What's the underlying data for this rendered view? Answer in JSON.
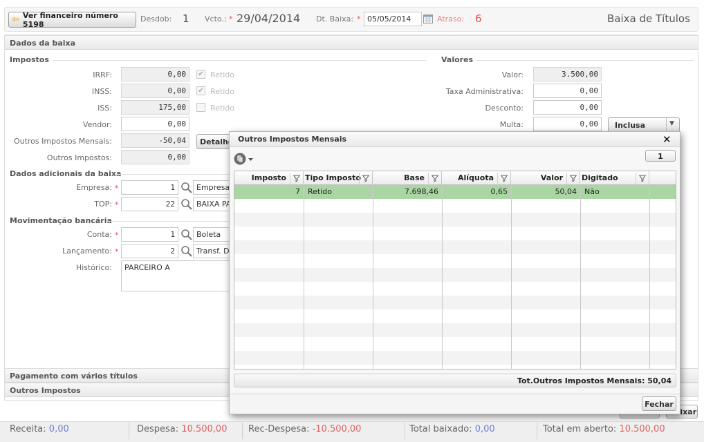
{
  "header": {
    "ver_financeiro_label": "Ver financeiro número 5198",
    "desdob_label": "Desdob:",
    "desdob_value": "1",
    "vcto_label": "Vcto.:",
    "vcto_value": "29/04/2014",
    "dt_baixa_label": "Dt. Baixa:",
    "dt_baixa_value": "05/05/2014",
    "atraso_label": "Atraso:",
    "atraso_value": "6",
    "page_title": "Baixa de Títulos",
    "required_mark": "*"
  },
  "dados_baixa": {
    "title": "Dados da baixa",
    "impostos_title": "Impostos",
    "impostos": [
      {
        "label": "IRRF:",
        "value": "0,00",
        "retido_label": "Retido",
        "checked": true
      },
      {
        "label": "INSS:",
        "value": "0,00",
        "retido_label": "Retido",
        "checked": true
      },
      {
        "label": "ISS:",
        "value": "175,00",
        "retido_label": "Retido",
        "checked": false
      }
    ],
    "vendor_label": "Vendor:",
    "vendor_value": "0,00",
    "outros_mensais_label": "Outros Impostos Mensais:",
    "outros_mensais_value": "-50,04",
    "detalhes_label": "Detalhes",
    "outros_impostos_label": "Outros Impostos:",
    "outros_impostos_value": "0,00",
    "valores_title": "Valores",
    "valor_label": "Valor:",
    "valor_value": "3.500,00",
    "taxa_label": "Taxa Administrativa:",
    "taxa_value": "0,00",
    "desconto_label": "Desconto:",
    "desconto_value": "0,00",
    "multa_label": "Multa:",
    "multa_value": "0,00",
    "multa_option": "Inclusa",
    "adicionais_title": "Dados adicionais da baixa",
    "empresa_label": "Empresa:",
    "empresa_code": "1",
    "empresa_name": "Empresa",
    "top_label": "TOP:",
    "top_code": "22",
    "top_name": "BAIXA PA",
    "mov_title": "Movimentação bancária",
    "conta_label": "Conta:",
    "conta_code": "1",
    "conta_name": "Boleta",
    "lancamento_label": "Lançamento:",
    "lancamento_code": "2",
    "lancamento_name": "Transf. D",
    "historico_label": "Histórico:",
    "historico_value": "PARCEIRO A"
  },
  "collapsed_sections": [
    "Pagamento com vários títulos",
    "Outros Impostos"
  ],
  "modal": {
    "title": "Outros Impostos Mensais",
    "close_symbol": "✕",
    "page_number": "1",
    "columns": [
      "Imposto",
      "Tipo Imposto",
      "Base",
      "Alíquota",
      "Valor",
      "Digitado"
    ],
    "rows": [
      [
        "7",
        "Retido",
        "7.698,46",
        "0,65",
        "50,04",
        "Não"
      ]
    ],
    "total_label": "Tot.Outros Impostos Mensais:",
    "total_value": "50,04",
    "fechar_label": "Fechar",
    "selected_row_color": "#a9d6a2"
  },
  "behind_footer": {
    "baixar_label": "aixar"
  },
  "bottom": {
    "receita_label": "Receita:",
    "receita_value": "0,00",
    "despesa_label": "Despesa:",
    "despesa_value": "10.500,00",
    "rec_despesa_label": "Rec-Despesa:",
    "rec_despesa_value": "-10.500,00",
    "total_baixado_label": "Total baixado:",
    "total_baixado_value": "0,00",
    "total_aberto_label": "Total em aberto:",
    "total_aberto_value": "10.500,00"
  },
  "colors": {
    "positive": "#6f7fd1",
    "negative": "#e06060",
    "required": "#e05050"
  }
}
